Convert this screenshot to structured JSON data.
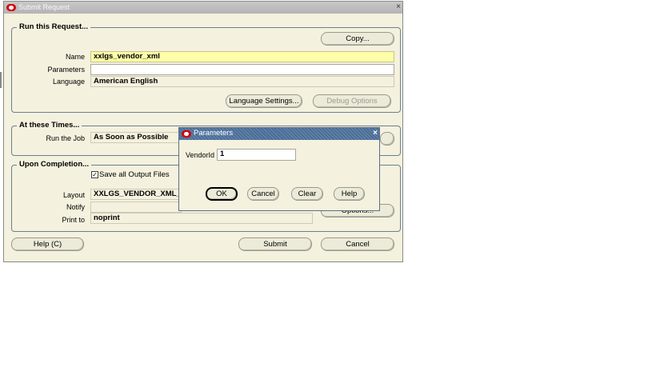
{
  "main_window": {
    "title": "Submit Request",
    "close_glyph": "×",
    "copy_button": "Copy...",
    "run_request": {
      "group_title": "Run this Request...",
      "name_label": "Name",
      "name_value": "xxlgs_vendor_xml",
      "parameters_label": "Parameters",
      "parameters_value": "",
      "language_label": "Language",
      "language_value": "American English",
      "language_settings_button": "Language Settings...",
      "debug_options_button": "Debug Options"
    },
    "at_these_times": {
      "group_title": "At these Times...",
      "run_job_label": "Run the Job",
      "run_job_value": "As Soon as Possible"
    },
    "upon_completion": {
      "group_title": "Upon Completion...",
      "save_output_label": "Save all Output Files",
      "save_output_checked": true,
      "layout_label": "Layout",
      "layout_value": "XXLGS_VENDOR_XML_T",
      "notify_label": "Notify",
      "notify_value": "",
      "print_to_label": "Print to",
      "print_to_value": "noprint",
      "options_button": "Options..."
    },
    "help_button": "Help (C)",
    "submit_button": "Submit",
    "cancel_button": "Cancel"
  },
  "parameters_dialog": {
    "title": "Parameters",
    "close_glyph": "×",
    "vendor_id_label": "VendorId",
    "vendor_id_value": "1",
    "ok_button": "OK",
    "cancel_button": "Cancel",
    "clear_button": "Clear",
    "help_button": "Help"
  },
  "colors": {
    "window_bg": "#f4f1de",
    "dialog_titlebar": "#4a6d98",
    "required_field": "#fefea8",
    "oracle_red": "#d40000"
  }
}
